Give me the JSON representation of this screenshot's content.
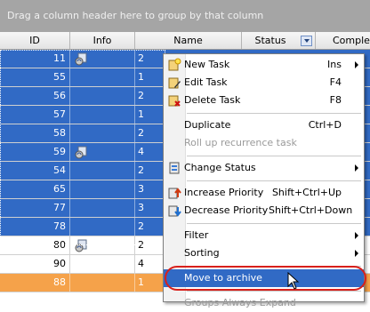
{
  "group_panel": {
    "hint": "Drag a column header here to group by that column"
  },
  "columns": {
    "id": "ID",
    "info": "Info",
    "name": "Name",
    "status": "Status",
    "completed": "Complet"
  },
  "rows": [
    {
      "id": "11",
      "name": "2",
      "icon": true,
      "state": "sel"
    },
    {
      "id": "55",
      "name": "1",
      "icon": false,
      "state": "sel"
    },
    {
      "id": "56",
      "name": "2",
      "icon": false,
      "state": "sel"
    },
    {
      "id": "57",
      "name": "1",
      "icon": false,
      "state": "sel"
    },
    {
      "id": "58",
      "name": "2",
      "icon": false,
      "state": "sel"
    },
    {
      "id": "59",
      "name": "4",
      "icon": true,
      "state": "sel"
    },
    {
      "id": "54",
      "name": "2",
      "icon": false,
      "state": "sel"
    },
    {
      "id": "65",
      "name": "3",
      "icon": false,
      "state": "sel"
    },
    {
      "id": "77",
      "name": "3",
      "icon": false,
      "state": "sel"
    },
    {
      "id": "78",
      "name": "2",
      "icon": false,
      "state": "sel"
    },
    {
      "id": "80",
      "name": "2",
      "icon": true,
      "state": "white"
    },
    {
      "id": "90",
      "name": "4",
      "icon": false,
      "state": "white"
    },
    {
      "id": "88",
      "name": "1",
      "icon": false,
      "state": "orange"
    }
  ],
  "menu": {
    "new_task": "New Task",
    "new_task_sc": "Ins",
    "edit_task": "Edit Task",
    "edit_task_sc": "F4",
    "delete_task": "Delete Task",
    "delete_task_sc": "F8",
    "duplicate": "Duplicate",
    "duplicate_sc": "Ctrl+D",
    "rollup": "Roll up recurrence task",
    "change_status": "Change Status",
    "increase_priority": "Increase Priority",
    "increase_priority_sc": "Shift+Ctrl+Up",
    "decrease_priority": "Decrease Priority",
    "decrease_priority_sc": "Shift+Ctrl+Down",
    "filter": "Filter",
    "sorting": "Sorting",
    "move_to_archive": "Move to archive",
    "groups_always_expand": "Groups Always Expand"
  },
  "colors": {
    "selection": "#316ac5",
    "highlight_ring": "#d8201b",
    "overdue_row": "#f5a24a"
  }
}
